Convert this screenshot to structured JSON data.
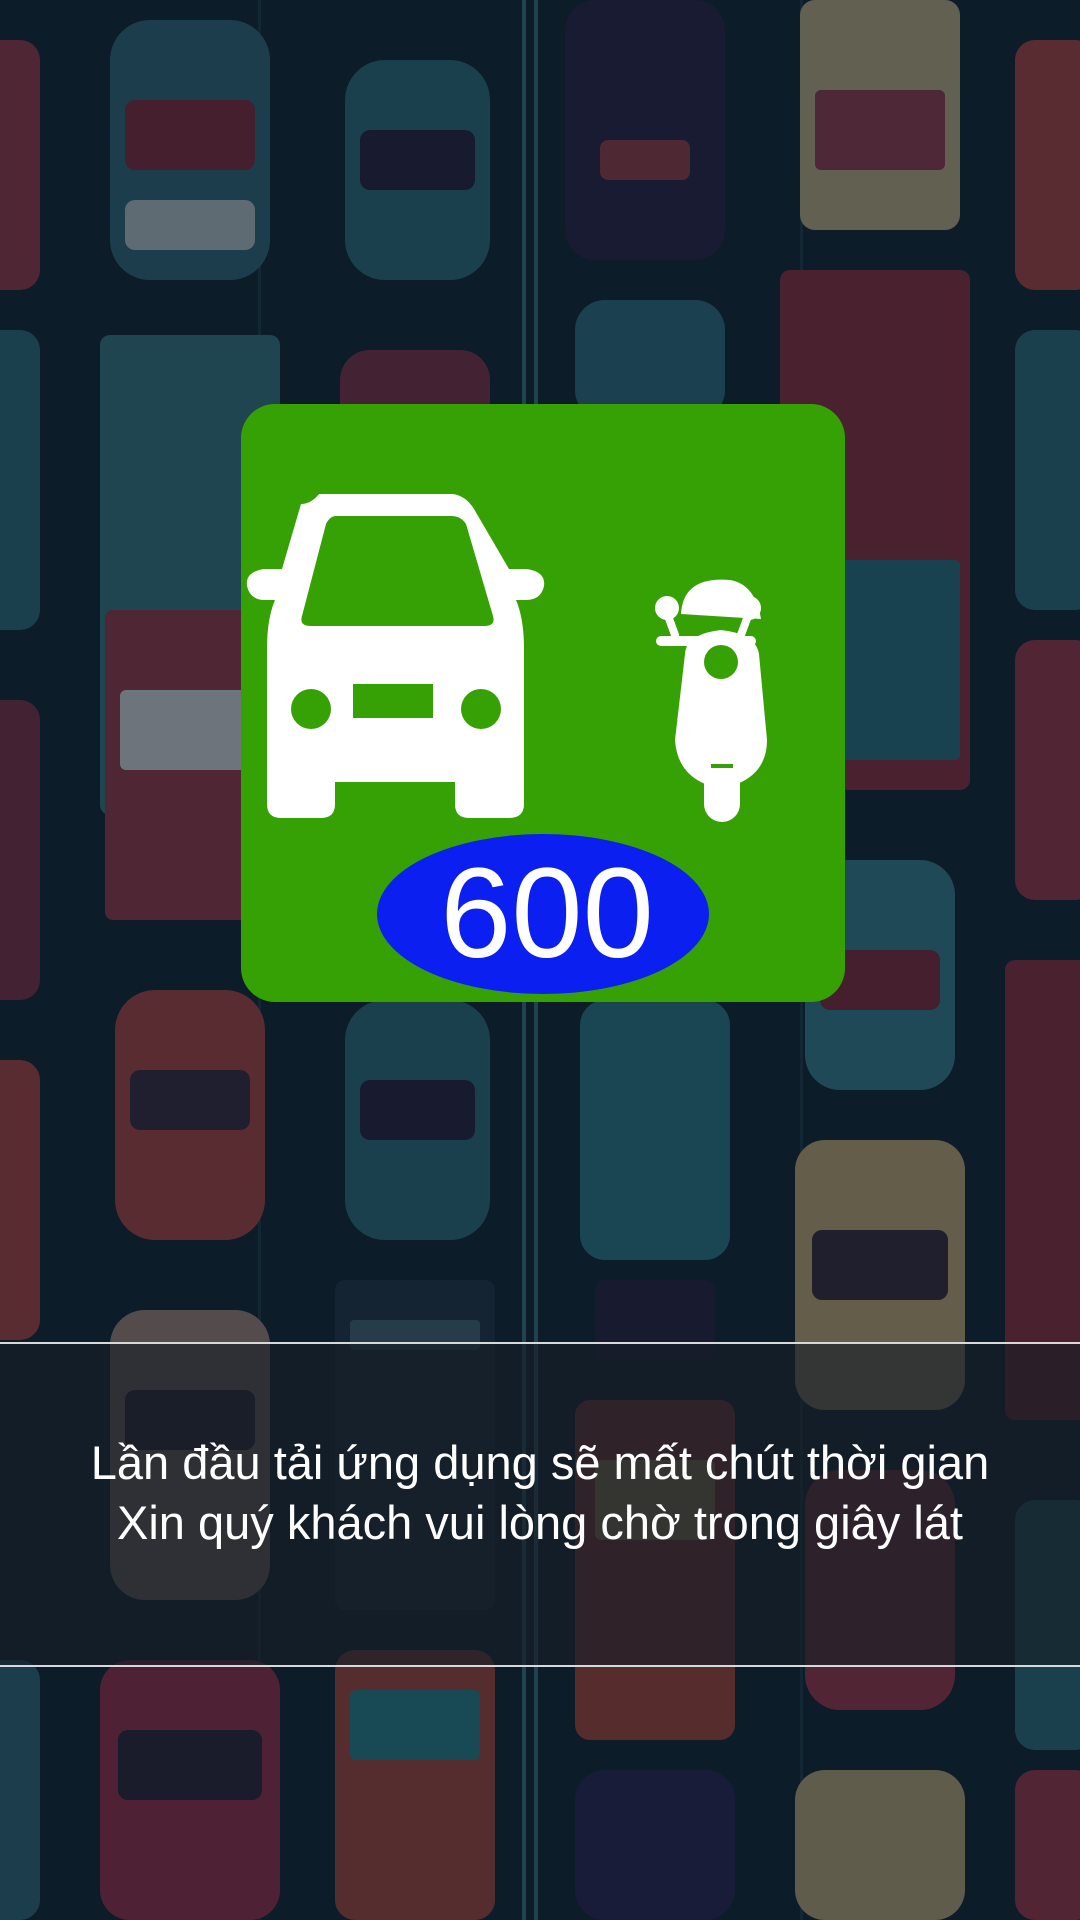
{
  "splash": {
    "logo": {
      "number": "600",
      "icons": [
        "car-icon",
        "motorbike-icon"
      ],
      "colors": {
        "tile": "#36a105",
        "badge": "#0a1ff0",
        "glyph": "#ffffff"
      }
    },
    "message": {
      "line1": "Lần đầu tải ứng dụng sẽ mất chút thời gian",
      "line2": "Xin quý khách vui lòng chờ trong giây lát"
    },
    "background": {
      "theme": "traffic-jam-illustration",
      "colors": [
        "#102431",
        "#34707e",
        "#a83b4a",
        "#d0b37a"
      ]
    }
  }
}
